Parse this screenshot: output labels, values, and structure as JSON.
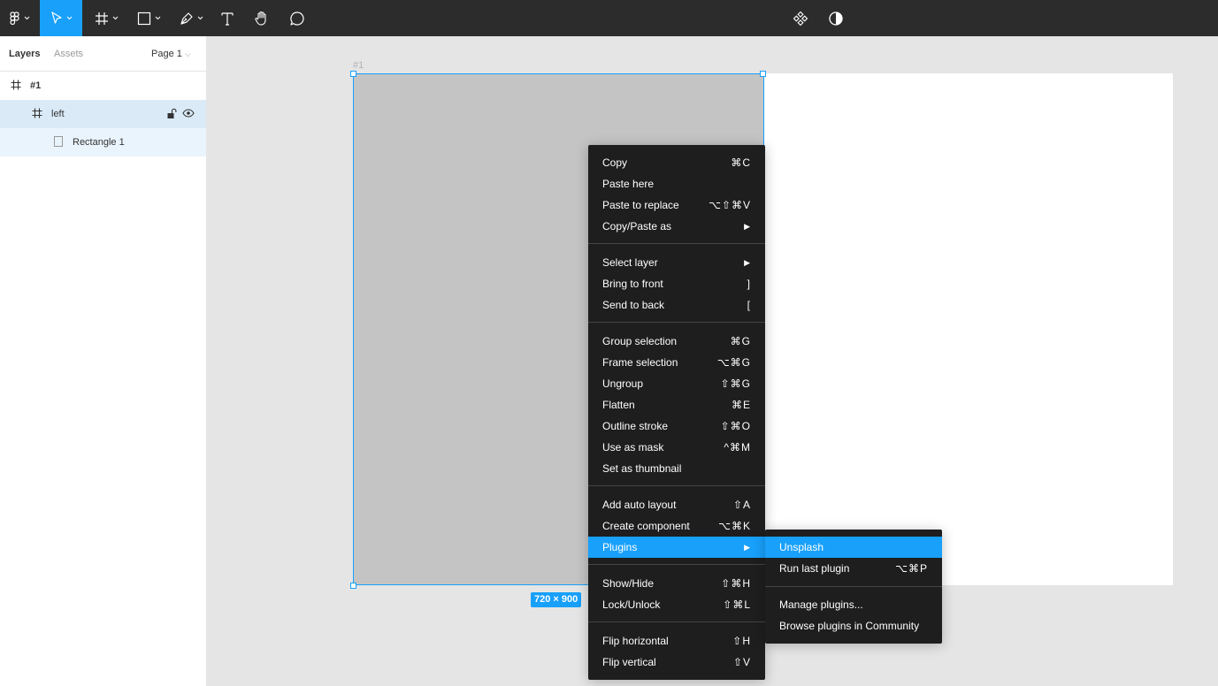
{
  "toolbar": {
    "tools": [
      "figma-menu",
      "move-tool",
      "frame-tool",
      "shape-tool",
      "pen-tool",
      "text-tool",
      "hand-tool",
      "comment-tool"
    ],
    "right_tools": [
      "components-icon",
      "theme-toggle-icon"
    ]
  },
  "panel": {
    "tabs": {
      "layers": "Layers",
      "assets": "Assets"
    },
    "page": "Page 1",
    "layers": [
      {
        "label": "#1",
        "type": "frame"
      },
      {
        "label": "left",
        "type": "frame"
      },
      {
        "label": "Rectangle 1",
        "type": "rectangle"
      }
    ]
  },
  "canvas": {
    "frame_title": "#1",
    "size_badge": "720 × 900"
  },
  "menu": {
    "items": [
      {
        "label": "Copy",
        "shortcut": "⌘C"
      },
      {
        "label": "Paste here",
        "shortcut": ""
      },
      {
        "label": "Paste to replace",
        "shortcut": "⌥⇧⌘V"
      },
      {
        "label": "Copy/Paste as",
        "shortcut": "▶"
      },
      {
        "label": "Select layer",
        "shortcut": "▶"
      },
      {
        "label": "Bring to front",
        "shortcut": "]"
      },
      {
        "label": "Send to back",
        "shortcut": "["
      },
      {
        "label": "Group selection",
        "shortcut": "⌘G"
      },
      {
        "label": "Frame selection",
        "shortcut": "⌥⌘G"
      },
      {
        "label": "Ungroup",
        "shortcut": "⇧⌘G"
      },
      {
        "label": "Flatten",
        "shortcut": "⌘E"
      },
      {
        "label": "Outline stroke",
        "shortcut": "⇧⌘O"
      },
      {
        "label": "Use as mask",
        "shortcut": "^⌘M"
      },
      {
        "label": "Set as thumbnail",
        "shortcut": ""
      },
      {
        "label": "Add auto layout",
        "shortcut": "⇧A"
      },
      {
        "label": "Create component",
        "shortcut": "⌥⌘K"
      },
      {
        "label": "Plugins",
        "shortcut": "▶"
      },
      {
        "label": "Show/Hide",
        "shortcut": "⇧⌘H"
      },
      {
        "label": "Lock/Unlock",
        "shortcut": "⇧⌘L"
      },
      {
        "label": "Flip horizontal",
        "shortcut": "⇧H"
      },
      {
        "label": "Flip vertical",
        "shortcut": "⇧V"
      }
    ]
  },
  "submenu": {
    "items": [
      {
        "label": "Unsplash",
        "shortcut": ""
      },
      {
        "label": "Run last plugin",
        "shortcut": "⌥⌘P"
      },
      {
        "label": "Manage plugins...",
        "shortcut": ""
      },
      {
        "label": "Browse plugins in Community",
        "shortcut": ""
      }
    ]
  },
  "colors": {
    "accent": "#18a0fb",
    "toolbar": "#2c2c2c",
    "menu": "#1e1e1e",
    "frame_fill": "#c4c4c4"
  }
}
